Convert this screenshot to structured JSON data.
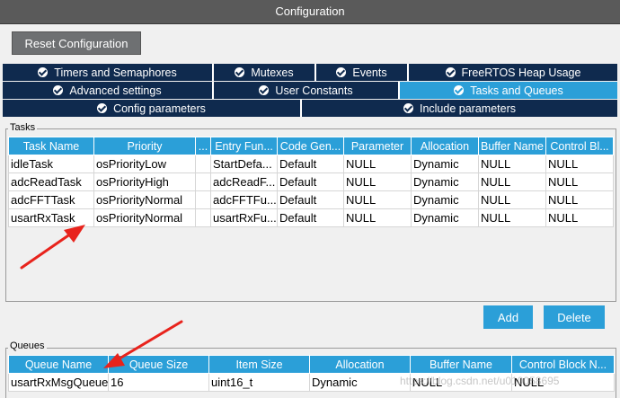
{
  "window": {
    "title": "Configuration"
  },
  "reset_label": "Reset Configuration",
  "tabs_row1": [
    {
      "label": "Timers and Semaphores",
      "active": false
    },
    {
      "label": "Mutexes",
      "active": false
    },
    {
      "label": "Events",
      "active": false
    },
    {
      "label": "FreeRTOS Heap Usage",
      "active": false
    }
  ],
  "tabs_row2": [
    {
      "label": "Advanced settings",
      "active": false
    },
    {
      "label": "User Constants",
      "active": false
    },
    {
      "label": "Tasks and Queues",
      "active": true
    }
  ],
  "tabs_row3": [
    {
      "label": "Config parameters",
      "active": false
    },
    {
      "label": "Include parameters",
      "active": false
    }
  ],
  "tasks": {
    "label": "Tasks",
    "headers": [
      "Task Name",
      "Priority",
      "...",
      "Entry Fun...",
      "Code Gen...",
      "Parameter",
      "Allocation",
      "Buffer Name",
      "Control Bl..."
    ],
    "rows": [
      [
        "idleTask",
        "osPriorityLow",
        "",
        "StartDefa...",
        "Default",
        "NULL",
        "Dynamic",
        "NULL",
        "NULL"
      ],
      [
        "adcReadTask",
        "osPriorityHigh",
        "",
        "adcReadF...",
        "Default",
        "NULL",
        "Dynamic",
        "NULL",
        "NULL"
      ],
      [
        "adcFFTTask",
        "osPriorityNormal",
        "",
        "adcFFTFu...",
        "Default",
        "NULL",
        "Dynamic",
        "NULL",
        "NULL"
      ],
      [
        "usartRxTask",
        "osPriorityNormal",
        "",
        "usartRxFu...",
        "Default",
        "NULL",
        "Dynamic",
        "NULL",
        "NULL"
      ]
    ],
    "add_label": "Add",
    "delete_label": "Delete"
  },
  "queues": {
    "label": "Queues",
    "headers": [
      "Queue Name",
      "Queue Size",
      "Item Size",
      "Allocation",
      "Buffer Name",
      "Control Block N..."
    ],
    "rows": [
      [
        "usartRxMsgQueue",
        "16",
        "uint16_t",
        "Dynamic",
        "NULL",
        "NULL"
      ]
    ]
  },
  "watermark": "https://blog.csdn.net/u010058695",
  "colors": {
    "tab_dark": "#0f2a4e",
    "tab_active": "#2b9fd8",
    "header": "#2b9fd8",
    "arrow": "#e8231c"
  }
}
